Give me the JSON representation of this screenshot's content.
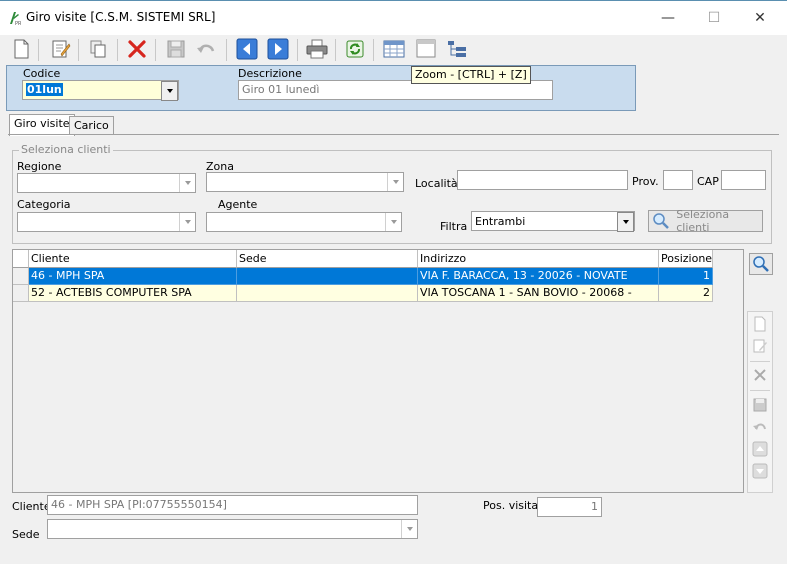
{
  "window": {
    "title": "Giro visite [C.S.M. SISTEMI SRL]",
    "minimize": "—",
    "maximize": "☐",
    "close": "✕"
  },
  "toolbar": {
    "icons": [
      "new-icon",
      "edit-icon",
      "copy-icon",
      "delete-icon",
      "save-icon",
      "undo-icon",
      "previous-icon",
      "next-icon",
      "print-icon",
      "refresh-icon",
      "grid-view-icon",
      "zoom-icon",
      "tree-icon"
    ],
    "tooltip": "Zoom - [CTRL] + [Z]"
  },
  "header": {
    "codice_label": "Codice",
    "codice_value": "01lun",
    "descrizione_label": "Descrizione",
    "descrizione_value": "Giro 01 lunedì"
  },
  "tabs": [
    "Giro visite",
    "Carico"
  ],
  "filters": {
    "legend": "Seleziona clienti",
    "regione_label": "Regione",
    "zona_label": "Zona",
    "localita_label": "Località",
    "prov_label": "Prov.",
    "cap_label": "CAP",
    "categoria_label": "Categoria",
    "agente_label": "Agente",
    "filtra_label": "Filtra",
    "filtra_value": "Entrambi",
    "seleziona_button": "Seleziona clienti"
  },
  "grid": {
    "columns": [
      "Cliente",
      "Sede",
      "Indirizzo",
      "Posizione"
    ],
    "rows": [
      {
        "cliente": "46 - MPH SPA",
        "sede": "",
        "indirizzo": "VIA F. BARACCA, 13 - 20026 - NOVATE",
        "posizione": "1"
      },
      {
        "cliente": "52 - ACTEBIS COMPUTER SPA",
        "sede": "",
        "indirizzo": "VIA TOSCANA 1 - SAN BOVIO - 20068 -",
        "posizione": "2"
      }
    ]
  },
  "footer": {
    "cliente_label": "Cliente",
    "cliente_value": "46 - MPH SPA [PI:07755550154]",
    "pos_visita_label": "Pos. visita",
    "pos_visita_value": "1",
    "sede_label": "Sede"
  },
  "colors": {
    "header_panel": "#c9dcee",
    "selection": "#0078d7",
    "alt_row": "#ffffe1"
  }
}
